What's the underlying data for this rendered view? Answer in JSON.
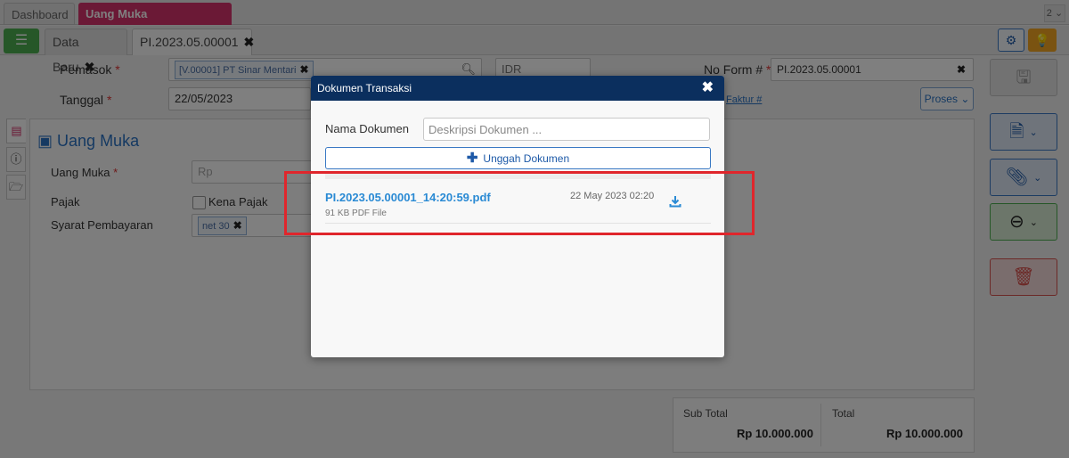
{
  "top_tabs": [
    {
      "label": "Dashboard"
    },
    {
      "label": "Uang Muka Pembelian",
      "close": "✖"
    }
  ],
  "top_count": "2",
  "sub_tabs": [
    {
      "label": "Data Baru",
      "close": "✖"
    },
    {
      "label": "PI.2023.05.00001",
      "close": "✖"
    }
  ],
  "form": {
    "pemasok_label": "Pemasok",
    "pemasok_value": "[V.00001] PT Sinar Mentari",
    "currency": "IDR",
    "tanggal_label": "Tanggal",
    "tanggal_value": "22/05/2023",
    "no_form_label": "No Form #",
    "no_form_value": "PI.2023.05.00001",
    "faktur_link": "Faktur #",
    "proses_label": "Proses",
    "required_mark": "*"
  },
  "panel": {
    "title": "Uang Muka",
    "uang_muka_label": "Uang Muka",
    "uang_muka_placeholder": "Rp",
    "pajak_label": "Pajak",
    "kena_pajak_label": "Kena Pajak",
    "syarat_label": "Syarat Pembayaran",
    "syarat_value": "net 30"
  },
  "totals": {
    "subtotal_label": "Sub Total",
    "subtotal_value": "Rp 10.000.000",
    "total_label": "Total",
    "total_value": "Rp 10.000.000"
  },
  "modal": {
    "title": "Dokumen Transaksi",
    "close": "✖",
    "nama_label": "Nama Dokumen",
    "nama_placeholder": "Deskripsi Dokumen ...",
    "upload_label": "Unggah Dokumen",
    "file": {
      "name": "PI.2023.05.00001_14:20:59.pdf",
      "meta": "91 KB PDF File",
      "date": "22 May 2023 02:20"
    }
  },
  "colors": {
    "accent": "#d6336c",
    "modal_header": "#0b2f5e",
    "link": "#2a8ad4",
    "highlight": "#e0262c"
  }
}
